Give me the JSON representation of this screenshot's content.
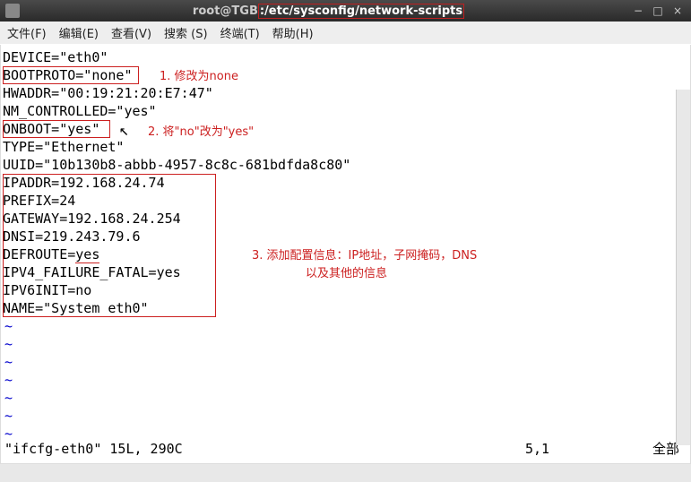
{
  "titlebar": {
    "prefix": "root@TGB",
    "path": ":/etc/sysconfig/network-scripts",
    "minimize": "−",
    "maximize": "□",
    "close": "×"
  },
  "menubar": {
    "file": "文件(F)",
    "edit": "编辑(E)",
    "view": "查看(V)",
    "search": "搜索 (S)",
    "terminal": "终端(T)",
    "help": "帮助(H)"
  },
  "content": {
    "l1": "DEVICE=\"eth0\"",
    "l2": "BOOTPROTO=\"none\"",
    "l3": "HWADDR=\"00:19:21:20:E7:47\"",
    "l4": "NM_CONTROLLED=\"yes\"",
    "l5": "ONBOOT=\"yes\"",
    "l6": "TYPE=\"Ethernet\"",
    "l7": "UUID=\"10b130b8-abbb-4957-8c8c-681bdfda8c80\"",
    "l8": "IPADDR=192.168.24.74",
    "l9": "PREFIX=24",
    "l10": "GATEWAY=192.168.24.254",
    "l11": "DNSI=219.243.79.6",
    "l12_a": "DEFROUTE=",
    "l12_b": "yes",
    "l13": "IPV4_FAILURE_FATAL=yes",
    "l14": "IPV6INIT=no",
    "l15": "NAME=\"System eth0\"",
    "tilde": "~"
  },
  "annotations": {
    "a1": "1. 修改为none",
    "a2": "2. 将\"no\"改为\"yes\"",
    "a3_line1": "3. 添加配置信息：IP地址，子网掩码，DNS",
    "a3_line2": "以及其他的信息"
  },
  "status": {
    "left": "\"ifcfg-eth0\" 15L, 290C",
    "mid": "5,1",
    "right": "全部"
  }
}
